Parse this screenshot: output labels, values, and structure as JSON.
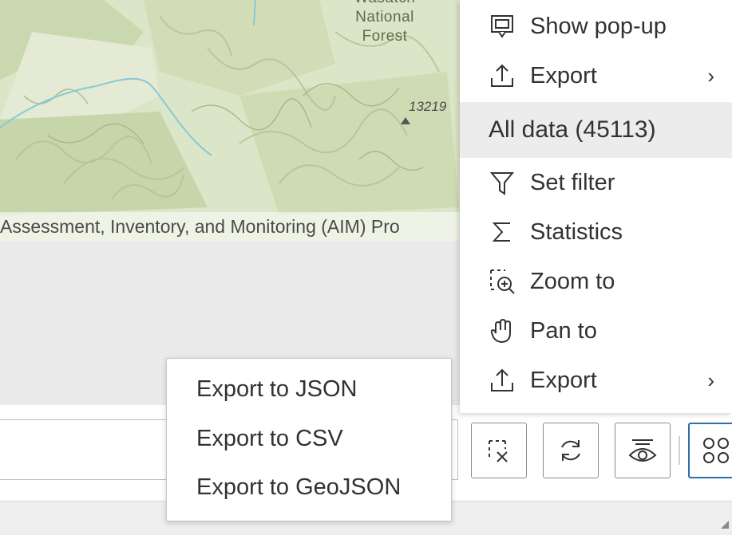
{
  "map": {
    "forest_label_line1": "Wasatch",
    "forest_label_line2": "National",
    "forest_label_line3": "Forest",
    "peak_elevation": "13219",
    "attribution": "Assessment, Inventory, and Monitoring (AIM) Pro"
  },
  "layer_menu": {
    "items_top": [
      {
        "label": "Show pop-up",
        "icon": "popup-icon"
      },
      {
        "label": "Export",
        "icon": "export-icon",
        "has_submenu": true
      }
    ],
    "section_header": "All data (45113)",
    "items_bottom": [
      {
        "label": "Set filter",
        "icon": "filter-icon"
      },
      {
        "label": "Statistics",
        "icon": "sigma-icon"
      },
      {
        "label": "Zoom to",
        "icon": "zoom-to-icon"
      },
      {
        "label": "Pan to",
        "icon": "hand-icon"
      },
      {
        "label": "Export",
        "icon": "export-icon",
        "has_submenu": true
      }
    ],
    "chevron": "›"
  },
  "export_submenu": {
    "items": [
      "Export to JSON",
      "Export to CSV",
      "Export to GeoJSON"
    ]
  },
  "toolbar": {
    "search_value": "",
    "buttons": [
      {
        "name": "clear-selection-button",
        "icon": "clear-selection-icon"
      },
      {
        "name": "refresh-button",
        "icon": "refresh-icon"
      },
      {
        "name": "toggle-visibility-button",
        "icon": "visibility-icon"
      },
      {
        "name": "layout-button",
        "icon": "grid-icon",
        "active": true
      }
    ]
  },
  "colors": {
    "accent": "#2e6fb0",
    "menu_header_bg": "#ececec",
    "map_green": "#d9e4c4"
  }
}
